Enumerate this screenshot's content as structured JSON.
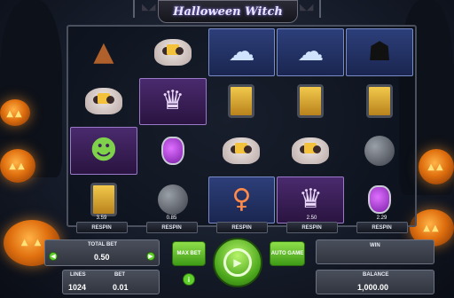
{
  "game": {
    "title": "Halloween Witch"
  },
  "reels": {
    "rows": [
      [
        "hat",
        "skull-candle",
        "ghost",
        "ghost",
        "cat"
      ],
      [
        "skull-candle",
        "vampire",
        "lantern",
        "lantern",
        "lantern"
      ],
      [
        "zombie",
        "potion",
        "skull-candle",
        "skull-candle",
        "bomb"
      ],
      [
        "lantern",
        "bomb",
        "witch",
        "vampire",
        "potion"
      ]
    ]
  },
  "respin": {
    "label": "RESPIN",
    "values": [
      "3.59",
      "0.85",
      "",
      "2.50",
      "2.29"
    ]
  },
  "total_bet": {
    "label": "TOTAL BET",
    "value": "0.50"
  },
  "lines": {
    "label": "LINES",
    "value": "1024"
  },
  "bet": {
    "label": "BET",
    "value": "0.01"
  },
  "buttons": {
    "max_bet": "MAX BET",
    "auto_game": "AUTO GAME",
    "info": "i"
  },
  "win": {
    "label": "WIN",
    "value": ""
  },
  "balance": {
    "label": "BALANCE",
    "value": "1,000.00"
  },
  "icons": {
    "spin": "spin-icon",
    "decrease": "minus-icon",
    "increase": "plus-icon"
  }
}
